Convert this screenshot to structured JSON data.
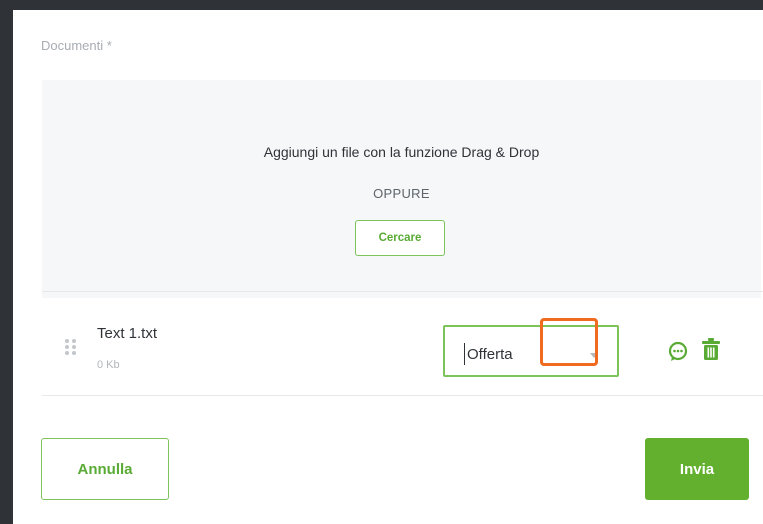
{
  "documents": {
    "label": "Documenti *",
    "dropzone": {
      "title": "Aggiungi un file con la funzione Drag & Drop",
      "or_text": "OPPURE",
      "browse_label": "Cercare"
    },
    "files": [
      {
        "name": "Text 1.txt",
        "size": "0 Kb",
        "type_value": "Offerta",
        "icons": [
          "drag-handle-icon",
          "comment-icon",
          "trash-icon"
        ]
      }
    ]
  },
  "actions": {
    "cancel_label": "Annulla",
    "submit_label": "Invia"
  },
  "colors": {
    "accent": "#62b02e",
    "accent_border": "#7cc35a",
    "highlight": "#f06a1f",
    "backdrop": "#2f3338"
  }
}
